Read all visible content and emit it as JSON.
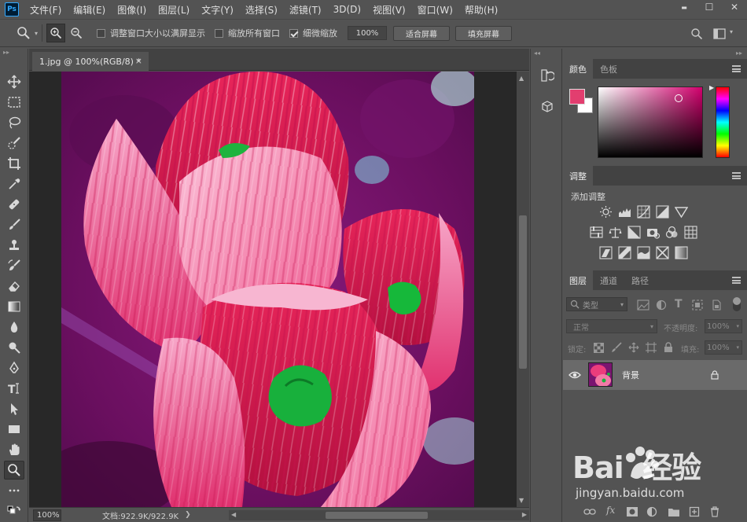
{
  "app": {
    "logo": "Ps"
  },
  "menu": [
    "文件(F)",
    "编辑(E)",
    "图像(I)",
    "图层(L)",
    "文字(Y)",
    "选择(S)",
    "滤镜(T)",
    "3D(D)",
    "视图(V)",
    "窗口(W)",
    "帮助(H)"
  ],
  "window_controls": {
    "minimize": "▬",
    "maximize": "☐",
    "close": "✕"
  },
  "options": {
    "resize_windows": "调整窗口大小以满屏显示",
    "zoom_all": "缩放所有窗口",
    "scrubby_zoom": "细微缩放",
    "zoom_value": "100%",
    "fit_screen": "适合屏幕",
    "fill_screen": "填充屏幕",
    "checks": {
      "resize_windows": false,
      "zoom_all": false,
      "scrubby_zoom": true
    }
  },
  "document": {
    "tab_title": "1.jpg @ 100%(RGB/8) *",
    "tab_close": "×",
    "zoom": "100%",
    "doc_size": "文档:922.9K/922.9K"
  },
  "panels": {
    "color_tab": "颜色",
    "swatches_tab": "色板",
    "adjustments_tab": "调整",
    "add_adjustment": "添加调整",
    "layers_tab": "图层",
    "channels_tab": "通道",
    "paths_tab": "路径",
    "filter_kind": "类型",
    "blend_mode": "正常",
    "opacity_label": "不透明度:",
    "opacity_value": "100%",
    "lock_label": "锁定:",
    "fill_label": "填充:",
    "fill_value": "100%",
    "layer_name": "背景",
    "fg_color": "#e23e6f",
    "bg_color": "#ffffff"
  },
  "watermark": {
    "brand": "Bai  经验",
    "url": "jingyan.baidu.com"
  }
}
